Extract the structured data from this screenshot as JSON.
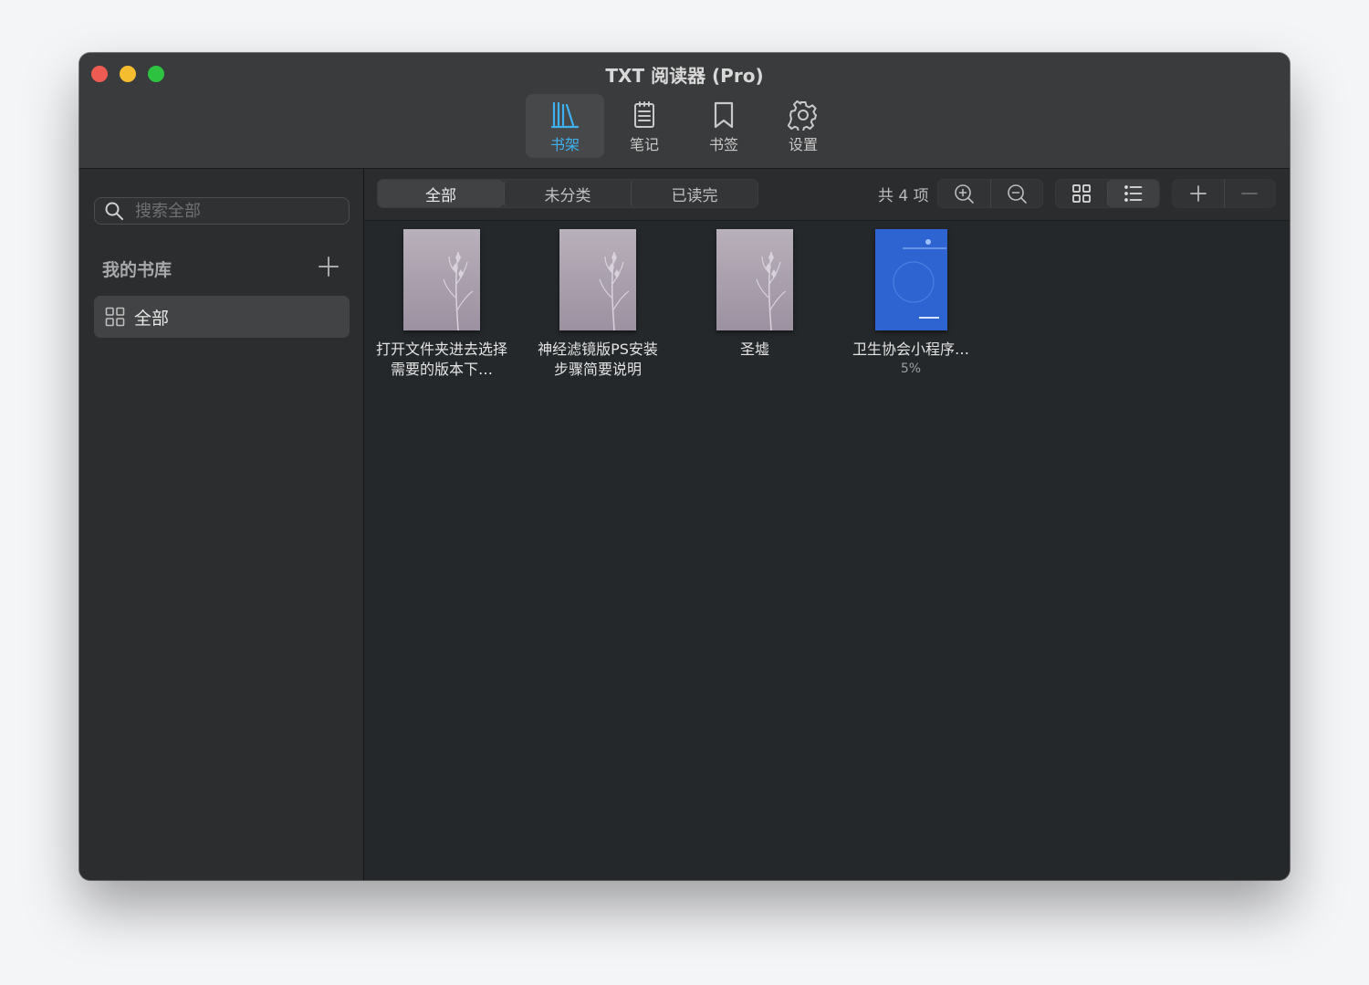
{
  "window": {
    "title": "TXT 阅读器 (Pro)"
  },
  "toolbar": {
    "items": [
      {
        "label": "书架",
        "icon": "bookshelf-icon",
        "active": true
      },
      {
        "label": "笔记",
        "icon": "notes-icon",
        "active": false
      },
      {
        "label": "书签",
        "icon": "bookmark-icon",
        "active": false
      },
      {
        "label": "设置",
        "icon": "gear-icon",
        "active": false
      }
    ]
  },
  "sidebar": {
    "search_placeholder": "搜索全部",
    "library_title": "我的书库",
    "items": [
      {
        "label": "全部",
        "icon": "grid-icon",
        "selected": true
      }
    ]
  },
  "filters": {
    "tabs": [
      "全部",
      "未分类",
      "已读完"
    ],
    "active": "全部"
  },
  "count_label": "共 4 项",
  "books": [
    {
      "title": "打开文件夹进去选择需要的版本下…",
      "cover": "wheat-cover",
      "progress": ""
    },
    {
      "title": "神经滤镜版PS安装步骤简要说明",
      "cover": "wheat-cover",
      "progress": ""
    },
    {
      "title": "圣墟",
      "cover": "wheat-cover",
      "progress": ""
    },
    {
      "title": "卫生协会小程序…",
      "cover": "blue-document-cover",
      "progress": "5%"
    }
  ],
  "colors": {
    "accent": "#3fb1f0",
    "close": "#ee5b52",
    "minimize": "#f3bd2f",
    "maximize": "#2dc341",
    "blue_cover": "#2e63d2"
  }
}
